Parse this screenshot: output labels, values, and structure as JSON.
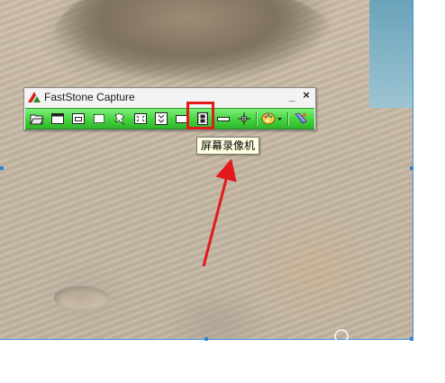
{
  "window": {
    "title": "FastStone Capture",
    "minimize_label": "_",
    "close_label": "×"
  },
  "toolbar": {
    "buttons": [
      {
        "name": "open-folder-icon",
        "label": ""
      },
      {
        "name": "capture-active-window-icon",
        "label": ""
      },
      {
        "name": "capture-window-object-icon",
        "label": ""
      },
      {
        "name": "capture-rectangular-region-icon",
        "label": ""
      },
      {
        "name": "capture-freehand-region-icon",
        "label": ""
      },
      {
        "name": "capture-full-screen-icon",
        "label": ""
      },
      {
        "name": "capture-scrolling-window-icon",
        "label": ""
      },
      {
        "name": "capture-fixed-region-icon",
        "label": ""
      },
      {
        "name": "screen-recorder-icon",
        "label": ""
      },
      {
        "name": "capture-menu-icon",
        "label": ""
      },
      {
        "name": "crosshair-icon",
        "label": ""
      },
      {
        "name": "output-palette-icon",
        "label": ""
      },
      {
        "name": "settings-icon",
        "label": ""
      }
    ],
    "accent_color": "#45d33f"
  },
  "tooltip": {
    "text": "屏幕录像机"
  },
  "annotation": {
    "highlight_color": "#e3191d",
    "arrow_color": "#e3191d"
  },
  "watermark": {
    "text": "  "
  }
}
